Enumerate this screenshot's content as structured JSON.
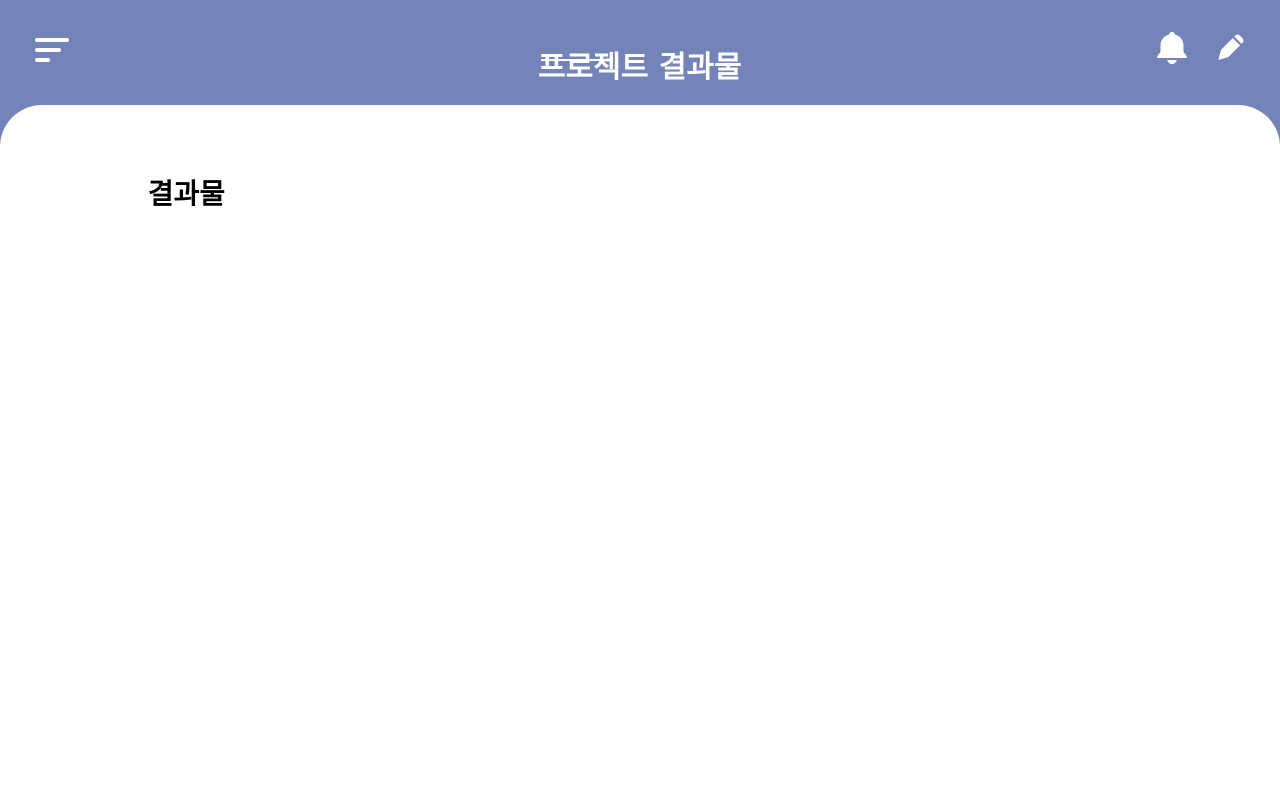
{
  "header": {
    "title": "프로젝트 결과물",
    "menu_icon": "menu-icon",
    "notification_icon": "bell-icon",
    "edit_icon": "pencil-icon",
    "background_color": "#7484b8",
    "foreground_color": "#ffffff"
  },
  "main": {
    "section_title": "결과물",
    "background_color": "#ffffff"
  }
}
